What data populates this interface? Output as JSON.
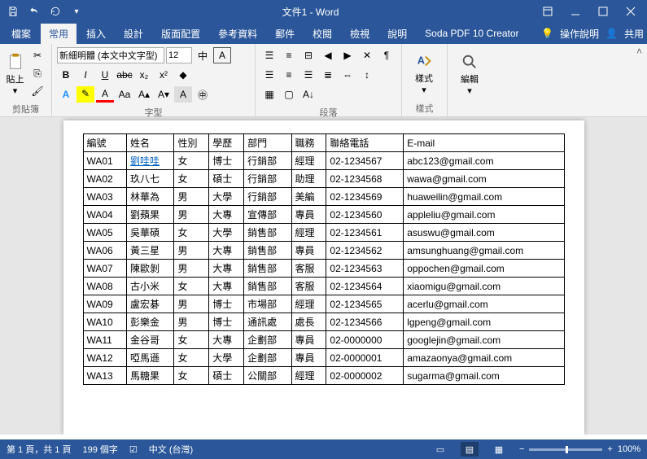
{
  "title": "文件1  -  Word",
  "tabs": [
    "檔案",
    "常用",
    "插入",
    "設計",
    "版面配置",
    "參考資料",
    "郵件",
    "校閱",
    "檢視",
    "說明",
    "Soda PDF 10 Creator"
  ],
  "activeTab": 1,
  "help": "操作說明",
  "share": "共用",
  "ribbon": {
    "clipboard": {
      "label": "剪貼簿",
      "paste": "貼上"
    },
    "font": {
      "label": "字型",
      "name": "新細明體 (本文中文字型)",
      "size": "12"
    },
    "paragraph": {
      "label": "段落"
    },
    "styles": {
      "label": "樣式",
      "btn": "樣式"
    },
    "editing": {
      "label": "",
      "btn": "編輯"
    }
  },
  "table": {
    "headers": [
      "編號",
      "姓名",
      "性別",
      "學歷",
      "部門",
      "職務",
      "聯絡電話",
      "E-mail"
    ],
    "rows": [
      [
        "WA01",
        "劉哇哇",
        "女",
        "博士",
        "行銷部",
        "經理",
        "02-1234567",
        "abc123@gmail.com"
      ],
      [
        "WA02",
        "玖八七",
        "女",
        "碩士",
        "行銷部",
        "助理",
        "02-1234568",
        "wawa@gmail.com"
      ],
      [
        "WA03",
        "林華為",
        "男",
        "大學",
        "行銷部",
        "美編",
        "02-1234569",
        "huaweilin@gmail.com"
      ],
      [
        "WA04",
        "劉蘋果",
        "男",
        "大專",
        "宣傳部",
        "專員",
        "02-1234560",
        "appleliu@gmail.com"
      ],
      [
        "WA05",
        "吳華碩",
        "女",
        "大學",
        "銷售部",
        "經理",
        "02-1234561",
        "asuswu@gmail.com"
      ],
      [
        "WA06",
        "黃三星",
        "男",
        "大專",
        "銷售部",
        "專員",
        "02-1234562",
        "amsunghuang@gmail.com"
      ],
      [
        "WA07",
        "陳歐剝",
        "男",
        "大專",
        "銷售部",
        "客服",
        "02-1234563",
        "oppochen@gmail.com"
      ],
      [
        "WA08",
        "古小米",
        "女",
        "大專",
        "銷售部",
        "客服",
        "02-1234564",
        "xiaomigu@gmail.com"
      ],
      [
        "WA09",
        "盧宏碁",
        "男",
        "博士",
        "市場部",
        "經理",
        "02-1234565",
        "acerlu@gmail.com"
      ],
      [
        "WA10",
        "彭樂金",
        "男",
        "博士",
        "通訊處",
        "處長",
        "02-1234566",
        "lgpeng@gmail.com"
      ],
      [
        "WA11",
        "金谷哥",
        "女",
        "大專",
        "企劃部",
        "專員",
        "02-0000000",
        "googlejin@gmail.com"
      ],
      [
        "WA12",
        "啞馬遜",
        "女",
        "大學",
        "企劃部",
        "專員",
        "02-0000001",
        "amazaonya@gmail.com"
      ],
      [
        "WA13",
        "馬糖果",
        "女",
        "碩士",
        "公關部",
        "經理",
        "02-0000002",
        "sugarma@gmail.com"
      ]
    ]
  },
  "status": {
    "page": "第 1 頁，共 1 頁",
    "words": "199 個字",
    "lang": "中文 (台灣)",
    "zoom": "100%"
  }
}
